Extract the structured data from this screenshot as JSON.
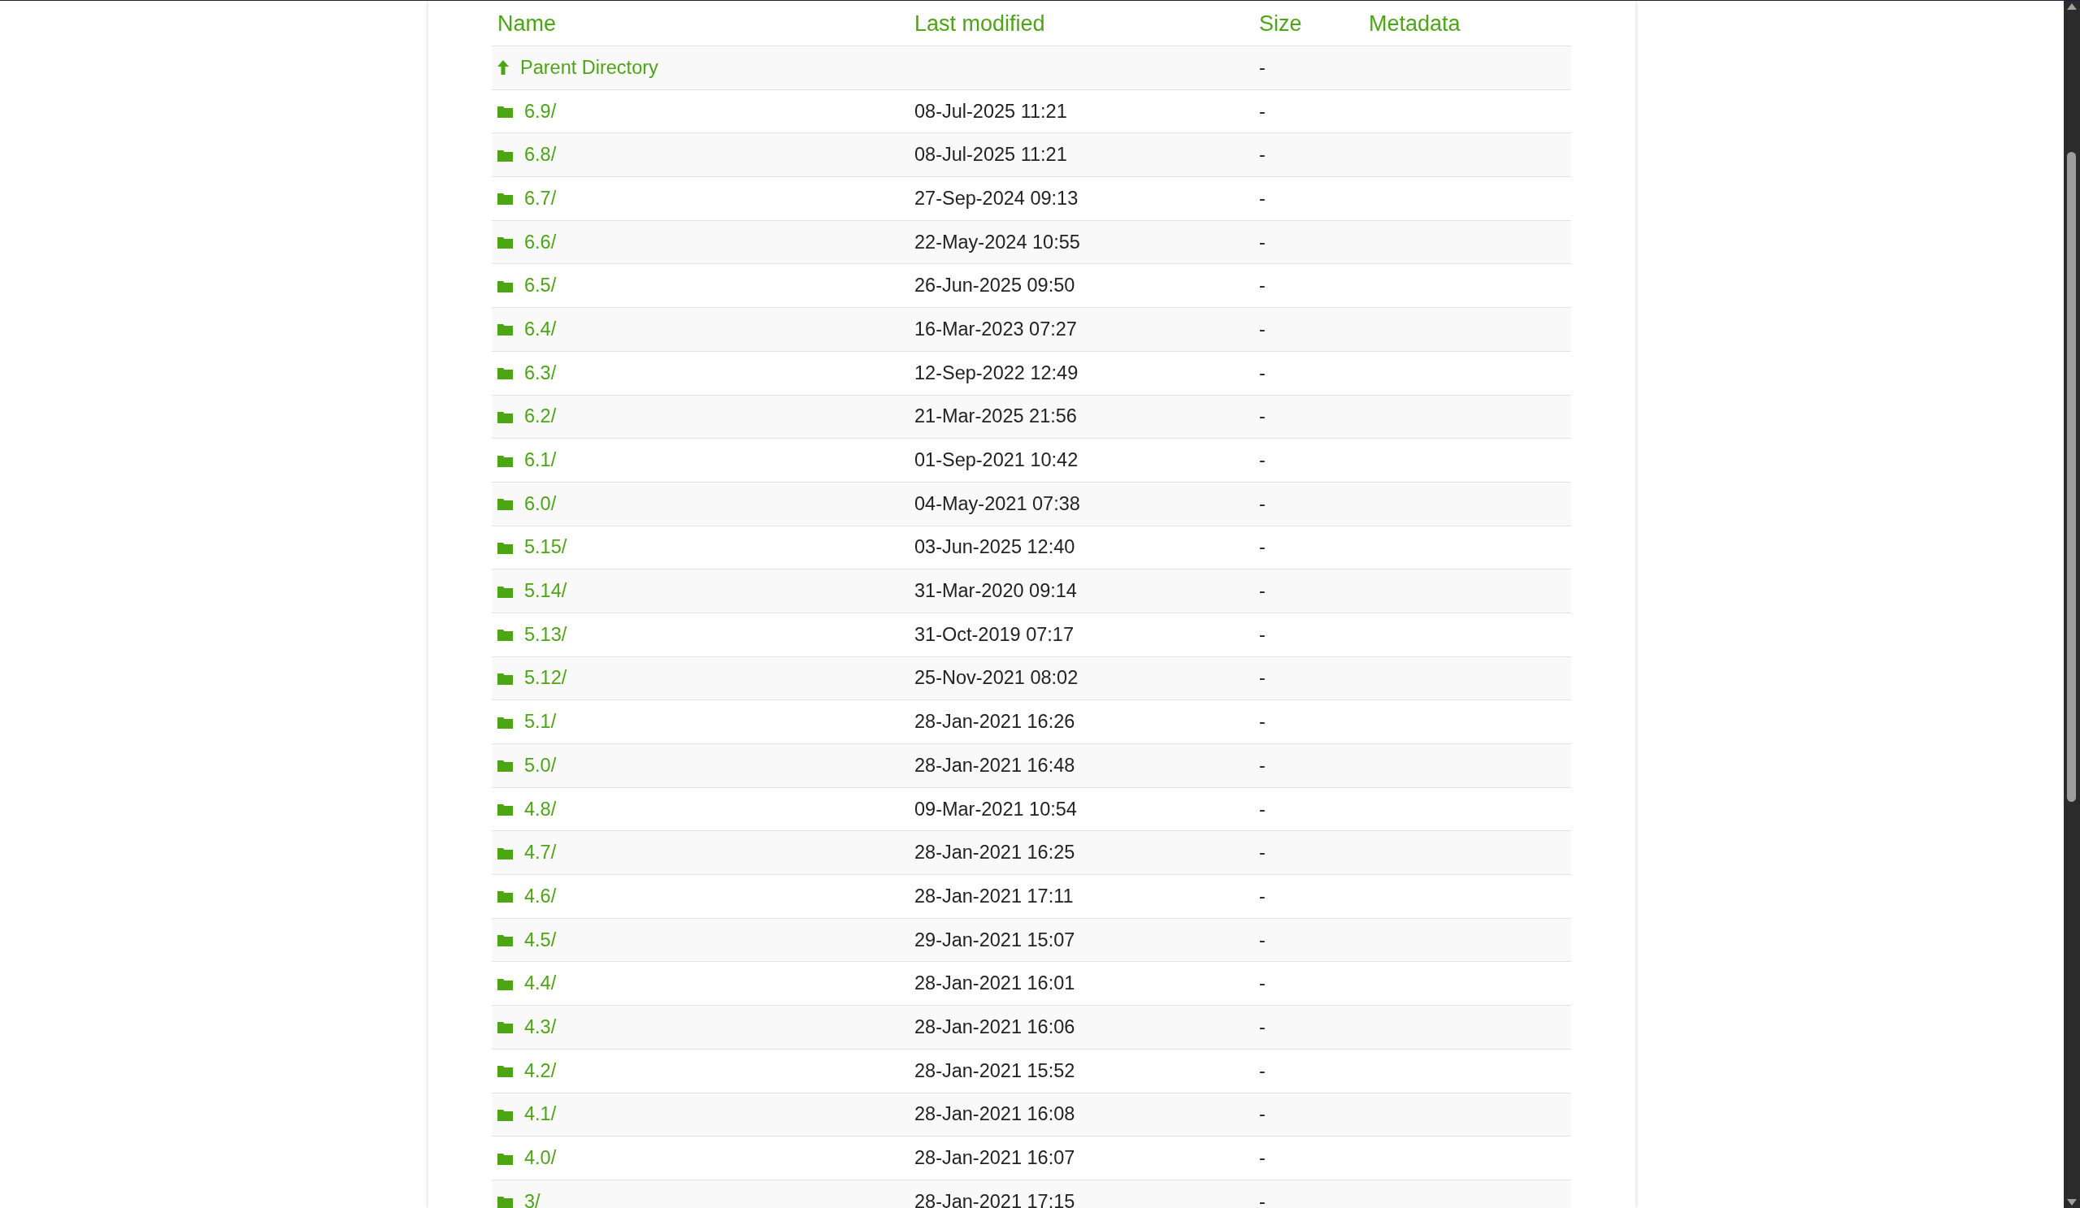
{
  "table": {
    "columns": [
      "Name",
      "Last modified",
      "Size",
      "Metadata"
    ],
    "rows": [
      {
        "kind": "parent",
        "name": "Parent Directory",
        "modified": "",
        "size": "-"
      },
      {
        "kind": "folder",
        "name": "6.9/",
        "modified": "08-Jul-2025 11:21",
        "size": "-"
      },
      {
        "kind": "folder",
        "name": "6.8/",
        "modified": "08-Jul-2025 11:21",
        "size": "-"
      },
      {
        "kind": "folder",
        "name": "6.7/",
        "modified": "27-Sep-2024 09:13",
        "size": "-"
      },
      {
        "kind": "folder",
        "name": "6.6/",
        "modified": "22-May-2024 10:55",
        "size": "-"
      },
      {
        "kind": "folder",
        "name": "6.5/",
        "modified": "26-Jun-2025 09:50",
        "size": "-"
      },
      {
        "kind": "folder",
        "name": "6.4/",
        "modified": "16-Mar-2023 07:27",
        "size": "-"
      },
      {
        "kind": "folder",
        "name": "6.3/",
        "modified": "12-Sep-2022 12:49",
        "size": "-"
      },
      {
        "kind": "folder",
        "name": "6.2/",
        "modified": "21-Mar-2025 21:56",
        "size": "-"
      },
      {
        "kind": "folder",
        "name": "6.1/",
        "modified": "01-Sep-2021 10:42",
        "size": "-"
      },
      {
        "kind": "folder",
        "name": "6.0/",
        "modified": "04-May-2021 07:38",
        "size": "-"
      },
      {
        "kind": "folder",
        "name": "5.15/",
        "modified": "03-Jun-2025 12:40",
        "size": "-"
      },
      {
        "kind": "folder",
        "name": "5.14/",
        "modified": "31-Mar-2020 09:14",
        "size": "-"
      },
      {
        "kind": "folder",
        "name": "5.13/",
        "modified": "31-Oct-2019 07:17",
        "size": "-"
      },
      {
        "kind": "folder",
        "name": "5.12/",
        "modified": "25-Nov-2021 08:02",
        "size": "-"
      },
      {
        "kind": "folder",
        "name": "5.1/",
        "modified": "28-Jan-2021 16:26",
        "size": "-"
      },
      {
        "kind": "folder",
        "name": "5.0/",
        "modified": "28-Jan-2021 16:48",
        "size": "-"
      },
      {
        "kind": "folder",
        "name": "4.8/",
        "modified": "09-Mar-2021 10:54",
        "size": "-"
      },
      {
        "kind": "folder",
        "name": "4.7/",
        "modified": "28-Jan-2021 16:25",
        "size": "-"
      },
      {
        "kind": "folder",
        "name": "4.6/",
        "modified": "28-Jan-2021 17:11",
        "size": "-"
      },
      {
        "kind": "folder",
        "name": "4.5/",
        "modified": "29-Jan-2021 15:07",
        "size": "-"
      },
      {
        "kind": "folder",
        "name": "4.4/",
        "modified": "28-Jan-2021 16:01",
        "size": "-"
      },
      {
        "kind": "folder",
        "name": "4.3/",
        "modified": "28-Jan-2021 16:06",
        "size": "-"
      },
      {
        "kind": "folder",
        "name": "4.2/",
        "modified": "28-Jan-2021 15:52",
        "size": "-"
      },
      {
        "kind": "folder",
        "name": "4.1/",
        "modified": "28-Jan-2021 16:08",
        "size": "-"
      },
      {
        "kind": "folder",
        "name": "4.0/",
        "modified": "28-Jan-2021 16:07",
        "size": "-"
      },
      {
        "kind": "folder",
        "name": "3/",
        "modified": "28-Jan-2021 17:15",
        "size": "-"
      }
    ]
  }
}
